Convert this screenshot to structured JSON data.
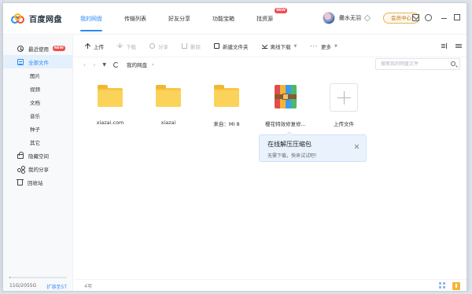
{
  "app": {
    "title": "百度网盘"
  },
  "nav": {
    "tabs": [
      {
        "label": "我的网盘",
        "active": true
      },
      {
        "label": "传输列表"
      },
      {
        "label": "好友分享"
      },
      {
        "label": "功能宝箱"
      },
      {
        "label": "找资源",
        "badge": "NEW"
      }
    ]
  },
  "user": {
    "name": "爨水无羽",
    "vip_label": "会员中心"
  },
  "sidebar": {
    "items": [
      {
        "label": "最近使用",
        "badge": "NEW",
        "icon": "clock-icon"
      },
      {
        "label": "全部文件",
        "icon": "file-icon",
        "active": true
      },
      {
        "label": "图片"
      },
      {
        "label": "视频"
      },
      {
        "label": "文档"
      },
      {
        "label": "音乐"
      },
      {
        "label": "种子"
      },
      {
        "label": "其它"
      },
      {
        "label": "隐藏空间",
        "icon": "lock-icon"
      },
      {
        "label": "我的分享",
        "icon": "share-icon"
      },
      {
        "label": "回收站",
        "icon": "trash-icon"
      }
    ],
    "storage": {
      "used": "11G/2055G",
      "expand": "扩容至5T",
      "fraction": 0.005
    }
  },
  "toolbar": {
    "upload": "上传",
    "download": "下载",
    "share": "分享",
    "delete": "删除",
    "new_folder": "新建文件夹",
    "offline": "离线下载",
    "more": "更多"
  },
  "address": {
    "crumb": "我的网盘",
    "search_placeholder": "搜索我的网盘文件"
  },
  "files": [
    {
      "name": "xiazai.com",
      "type": "folder"
    },
    {
      "name": "xiazai",
      "type": "folder"
    },
    {
      "name": "来自：MI 8",
      "type": "folder"
    },
    {
      "name": "樱花特效修复修...",
      "type": "rar"
    },
    {
      "name": "上传文件",
      "type": "upload"
    }
  ],
  "tip": {
    "title": "在线解压压缩包",
    "body": "无需下载，快来试试吧！"
  },
  "status": {
    "count": "4项"
  },
  "colors": {
    "accent": "#2b8af6",
    "folder": "#f7c645",
    "badge": "#f24c4c"
  }
}
